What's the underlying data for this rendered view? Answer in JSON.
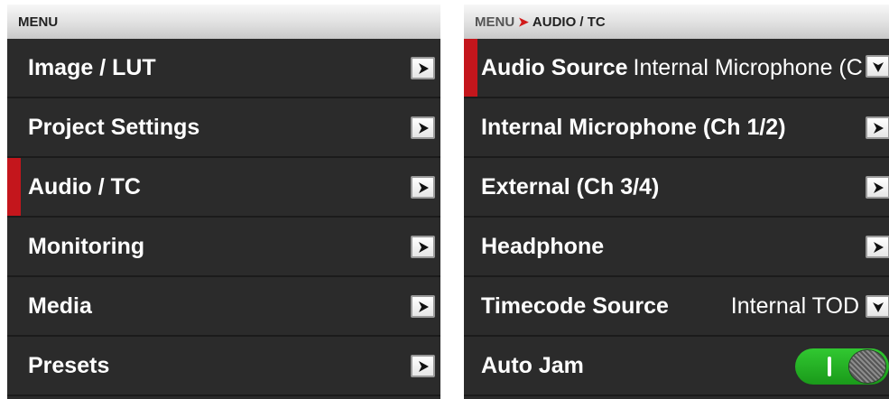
{
  "left_menu": {
    "header": "MENU",
    "items": [
      {
        "label": "Image / LUT",
        "selected": false
      },
      {
        "label": "Project Settings",
        "selected": false
      },
      {
        "label": "Audio / TC",
        "selected": true
      },
      {
        "label": "Monitoring",
        "selected": false
      },
      {
        "label": "Media",
        "selected": false
      },
      {
        "label": "Presets",
        "selected": false
      }
    ]
  },
  "right_menu": {
    "breadcrumb": {
      "root": "MENU",
      "separator": "➤",
      "current": "AUDIO / TC"
    },
    "audio_source": {
      "label": "Audio Source",
      "value": "Internal Microphone (C"
    },
    "internal_microphone": {
      "label": "Internal Microphone (Ch 1/2)"
    },
    "external": {
      "label": "External (Ch 3/4)"
    },
    "headphone": {
      "label": "Headphone"
    },
    "timecode_source": {
      "label": "Timecode Source",
      "value": "Internal TOD"
    },
    "auto_jam": {
      "label": "Auto Jam",
      "enabled": true
    }
  },
  "colors": {
    "accent": "#c4161c",
    "toggle_on": "#22b022",
    "panel_bg": "#2b2b2b"
  },
  "icons": {
    "submenu": "chevron-right-icon",
    "dropdown": "chevron-down-icon"
  }
}
